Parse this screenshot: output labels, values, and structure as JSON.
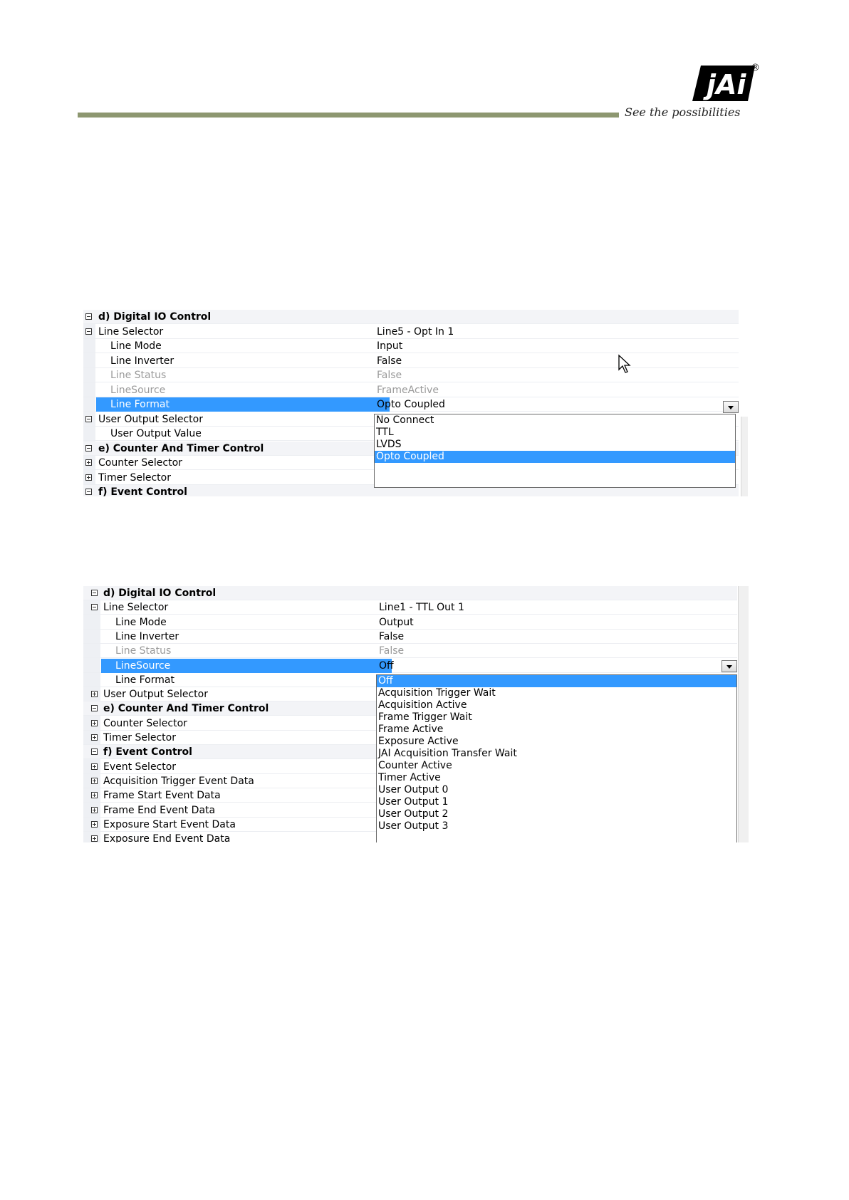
{
  "header": {
    "logo_text": "jAi",
    "registered_mark": "®",
    "tagline": "See the possibilities",
    "rule_color": "#8d9770"
  },
  "colors": {
    "selection": "#3399ff",
    "disabled_text": "#9a9a9a"
  },
  "panel1": {
    "rows": [
      {
        "name": "d) Digital IO Control",
        "value": "",
        "kind": "category",
        "expander": "minus"
      },
      {
        "name": "Line Selector",
        "value": "Line5 - Opt In 1",
        "kind": "normal",
        "expander": "minus"
      },
      {
        "name": "Line Mode",
        "value": "Input",
        "kind": "child"
      },
      {
        "name": "Line Inverter",
        "value": "False",
        "kind": "child"
      },
      {
        "name": "Line Status",
        "value": "False",
        "kind": "disabled"
      },
      {
        "name": "LineSource",
        "value": "FrameActive",
        "kind": "disabled"
      },
      {
        "name": "Line Format",
        "value": "Opto Coupled",
        "kind": "selected"
      },
      {
        "name": "User Output Selector",
        "value": "",
        "kind": "normal",
        "expander": "minus"
      },
      {
        "name": "User Output Value",
        "value": "",
        "kind": "child"
      },
      {
        "name": "e) Counter And Timer Control",
        "value": "",
        "kind": "category",
        "expander": "minus"
      },
      {
        "name": "Counter Selector",
        "value": "",
        "kind": "normal",
        "expander": "plus"
      },
      {
        "name": "Timer Selector",
        "value": "",
        "kind": "normal",
        "expander": "plus"
      },
      {
        "name": "f) Event Control",
        "value": "",
        "kind": "category",
        "expander": "minus"
      }
    ],
    "dropdown": {
      "options": [
        "No Connect",
        "TTL",
        "LVDS",
        "Opto Coupled"
      ],
      "selected": "Opto Coupled"
    }
  },
  "panel2": {
    "rows": [
      {
        "name": "d) Digital IO Control",
        "value": "",
        "kind": "category",
        "expander": "minus"
      },
      {
        "name": "Line Selector",
        "value": "Line1 - TTL Out 1",
        "kind": "normal",
        "expander": "minus"
      },
      {
        "name": "Line Mode",
        "value": "Output",
        "kind": "child"
      },
      {
        "name": "Line Inverter",
        "value": "False",
        "kind": "child"
      },
      {
        "name": "Line Status",
        "value": "False",
        "kind": "disabled"
      },
      {
        "name": "LineSource",
        "value": "Off",
        "kind": "selected"
      },
      {
        "name": "Line Format",
        "value": "",
        "kind": "child"
      },
      {
        "name": "User Output Selector",
        "value": "",
        "kind": "normal",
        "expander": "plus"
      },
      {
        "name": "e) Counter And Timer Control",
        "value": "",
        "kind": "category",
        "expander": "minus"
      },
      {
        "name": "Counter Selector",
        "value": "",
        "kind": "normal",
        "expander": "plus"
      },
      {
        "name": "Timer Selector",
        "value": "",
        "kind": "normal",
        "expander": "plus"
      },
      {
        "name": "f) Event Control",
        "value": "",
        "kind": "category",
        "expander": "minus"
      },
      {
        "name": "Event Selector",
        "value": "",
        "kind": "normal",
        "expander": "plus"
      },
      {
        "name": "Acquisition Trigger Event Data",
        "value": "",
        "kind": "normal",
        "expander": "plus"
      },
      {
        "name": "Frame Start Event Data",
        "value": "",
        "kind": "normal",
        "expander": "plus"
      },
      {
        "name": "Frame End Event Data",
        "value": "",
        "kind": "normal",
        "expander": "plus"
      },
      {
        "name": "Exposure Start Event Data",
        "value": "",
        "kind": "normal",
        "expander": "plus"
      },
      {
        "name": "Exposure End Event Data",
        "value": "",
        "kind": "normal",
        "expander": "plus"
      }
    ],
    "dropdown": {
      "options": [
        "Off",
        "Acquisition Trigger Wait",
        "Acquisition Active",
        "Frame Trigger Wait",
        "Frame Active",
        "Exposure Active",
        "JAI Acquisition Transfer Wait",
        "Counter Active",
        "Timer Active",
        "User Output 0",
        "User Output 1",
        "User Output 2",
        "User Output 3"
      ],
      "selected": "Off"
    }
  }
}
